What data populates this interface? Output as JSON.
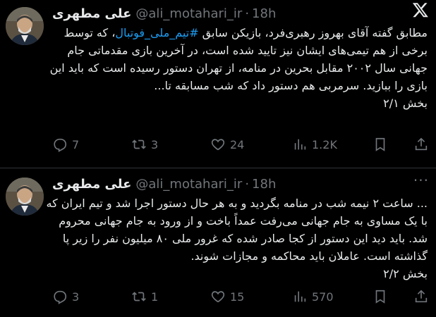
{
  "tweets": [
    {
      "author_name": "علی مطهری",
      "handle": "@ali_motahari_ir",
      "separator": "·",
      "time": "18h",
      "text_before_hashtag": "مطابق گفته آقای بهروز رهبری‌فرد، بازیکن سابق ",
      "hashtag": "#تیم_ملی_فوتبال",
      "text_after_hashtag": "، که توسط برخی از هم تیمی‌های ایشان نیز تایید شده است، در آخرین بازی مقدماتی جام جهانی سال ۲۰۰۲ مقابل بحرین در منامه، از تهران دستور رسیده است که باید این بازی را ببازید. سرمربی هم دستور داد که شب مسابقه تا...",
      "part": "بخش ۲/۱",
      "replies": "7",
      "retweets": "3",
      "likes": "24",
      "views": "1.2K"
    },
    {
      "author_name": "علی مطهری",
      "handle": "@ali_motahari_ir",
      "separator": "·",
      "time": "18h",
      "more": "···",
      "text": "... ساعت ۲ نیمه شب در منامه بگردید و به هر حال دستور اجرا شد و تیم ایران که با یک مساوی به جام جهانی می‌رفت  عمداً باخت و از ورود به جام جهانی محروم شد. باید دید این دستور از کجا صادر شده که غرور ملی ۸۰ میلیون نفر را زیر پا گذاشته است. عاملان باید محاکمه و مجازات شوند.",
      "part": "بخش ۲/۲",
      "replies": "3",
      "retweets": "1",
      "likes": "15",
      "views": "570"
    }
  ],
  "icons": {
    "brand": "x-logo-icon",
    "reply": "reply-icon",
    "retweet": "retweet-icon",
    "like": "heart-icon",
    "views": "views-icon",
    "bookmark": "bookmark-icon",
    "share": "share-icon"
  },
  "colors": {
    "background": "#000000",
    "text": "#e7e9ea",
    "muted": "#71767b",
    "link": "#1d9bf0",
    "divider": "#2f3336"
  }
}
